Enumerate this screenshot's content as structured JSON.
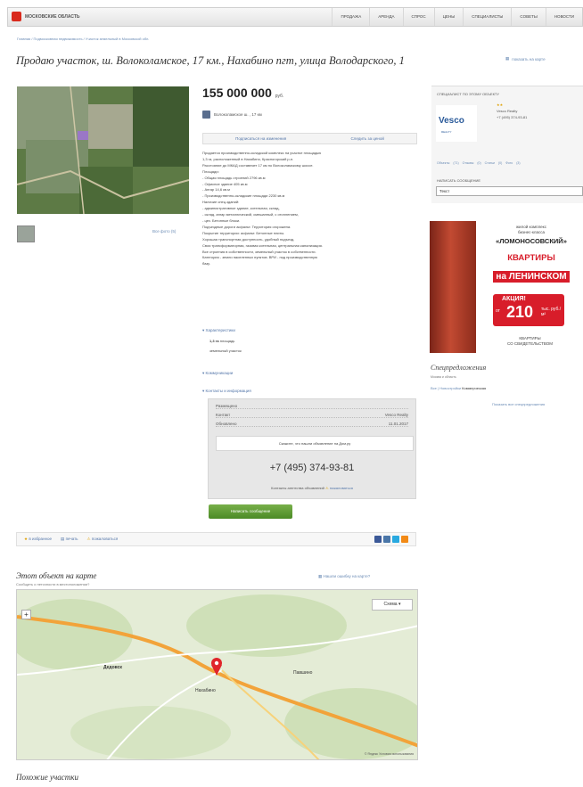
{
  "header": {
    "logo_text": "МОСКОВСКИЕ ОБЛАСТЬ",
    "nav": [
      "ПРОДАЖА",
      "АРЕНДА",
      "СПРОС",
      "ЦЕНЫ",
      "СПЕЦИАЛИСТЫ",
      "СОВЕТЫ",
      "НОВОСТИ"
    ]
  },
  "breadcrumb": "Главная / Подмосковная недвижимость / Участок земельный в Московской обл.",
  "listing": {
    "title": "Продаю участок, ш. Волоколамское, 17 км., Нахабино пгт, улица Володарского, 1",
    "map_link": "показать на карте",
    "price": "155 000 000",
    "price_unit": "руб.",
    "seller": "Волоколамское ш. , 17 км",
    "action_left": "Подписаться на изменения",
    "action_right": "Следить за ценой",
    "all_photos": "Все фото (5)",
    "description": [
      "Продается производственно-складской комплекс на участке площадью",
      "1,3 га, расположенный в Нахабино, Красногорский р-н.",
      "Расстояние до МКАД составляет 17 км по Волоколамскому шоссе.",
      "Площади:",
      "- Общая площадь строений 2796 кв.м",
      "- Офисное здание 405 кв.м",
      "- Ангар 14,6 кв.м",
      "- Производственно-складские площади 2230 кв.м",
      "Наличие спец.зданий:",
      "- административное здание, котельная, склад,",
      "- склад, ангар металлический, смешанный, с отоплением,",
      "- цех. Бетонные блоки.",
      "Подъездные дороги асфальт. Территория огорожена.",
      "Покрытие территории: асфальт. Бетонные плиты.",
      "Хорошая транспортная доступность, удобный подъезд.",
      "Своя трансформаторная, газовая котельная, центральная канализация.",
      "Все строения в собственности, земельный участок в собственности.",
      "Категория - земли населенных пунктов. ВРИ - под производственную",
      "базу."
    ],
    "section_area": "Характеристики",
    "area_value": "1,3 га",
    "area_label": "площадь",
    "area_extra": "земельный участок",
    "section_comm": "Коммуникации",
    "section_contacts": "Контакты и информация",
    "kv": [
      {
        "k": "Размещено",
        "v": ""
      },
      {
        "k": "Контакт",
        "v": "Vesco Realty"
      },
      {
        "k": "Обновлено",
        "v": "11.01.2017"
      }
    ],
    "notice": "Скажите, что нашли объявление на Дом.ру",
    "phone": "+7 (495) 374-93-81",
    "contact_foot": "Контакты агентства объявлений",
    "contact_foot_link": "пожаловаться",
    "green_button": "Написать сообщение"
  },
  "social": {
    "favorite": "в избранное",
    "print": "печать",
    "complain": "пожаловаться"
  },
  "map_section": {
    "title": "Этот объект на карте",
    "subtitle": "Сообщить о неточности в местоположении?",
    "problem_link": "Нашли ошибку на карте?",
    "scheme": "Схема",
    "zoom": "+",
    "labels": [
      "Дедовск",
      "Нахабино",
      "Павшино"
    ],
    "copyright": "© Яндекс  Условия использования"
  },
  "similar": "Похожие участки",
  "agent": {
    "header": "СПЕЦИАЛИСТ ПО ЭТОМУ ОБЪЕКТУ",
    "logo": "Vesco",
    "logo_sub": "REALTY",
    "name": "Vesco Realty",
    "phone": "+7 (495) 374-93-81",
    "links": "Объекты (71)  Отзывы (0)  Статьи (0)  Фото (3)",
    "write_label": "НАПИСАТЬ СООБЩЕНИЕ",
    "select_value": "Текст"
  },
  "ad": {
    "l1": "жилой комплекс",
    "l2": "бизнес-класса",
    "l3": "«ЛОМОНОСОВСКИЙ»",
    "kv1": "КВАРТИРЫ",
    "kv2": "на ЛЕНИНСКОМ",
    "promo": "АКЦИЯ!",
    "from": "от",
    "num": "210",
    "unit": "тыс. руб./м²",
    "foot1": "КВАРТИРЫ",
    "foot2": "СО СВИДЕТЕЛЬСТВОМ"
  },
  "special": {
    "title": "Спецпредложения",
    "sub": "Москва и область",
    "row_link": "Все | Новостройки",
    "row_text": "Коммерческая",
    "all": "Показать все спецпредложения"
  },
  "colors": {
    "accent": "#d9291c",
    "link": "#6a8bb5",
    "button_green": "#5a9a33",
    "ad_red": "#d81d2a"
  }
}
